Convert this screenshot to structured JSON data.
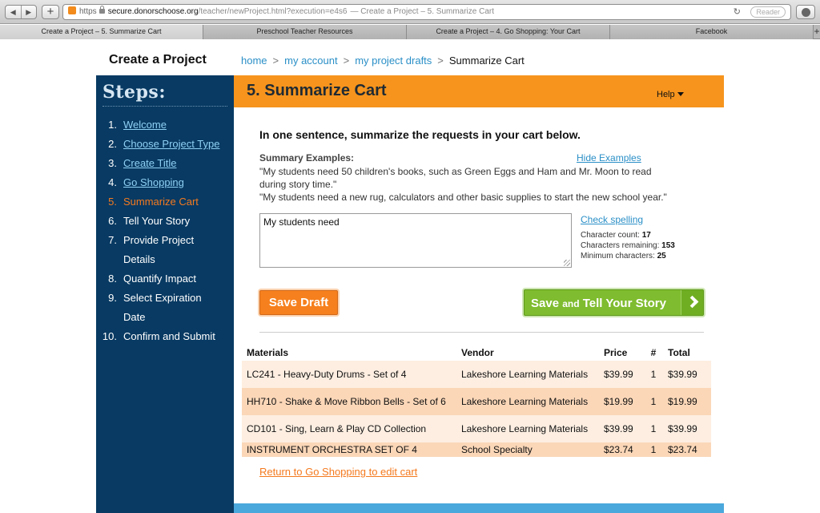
{
  "browser": {
    "url_scheme": "https",
    "url_domain": "secure.donorschoose.org",
    "url_path": "/teacher/newProject.html?execution=e4s6",
    "window_title": "— Create a Project – 5. Summarize Cart",
    "reload_icon": "reload-icon",
    "reader_label": "Reader",
    "tabs": [
      {
        "label": "Create a Project – 5. Summarize Cart"
      },
      {
        "label": "Preschool Teacher Resources"
      },
      {
        "label": "Create a Project – 4. Go Shopping: Your Cart"
      },
      {
        "label": "Facebook"
      }
    ],
    "new_tab_label": "+"
  },
  "header": {
    "title": "Create a Project",
    "breadcrumbs": [
      "home",
      "my account",
      "my project drafts"
    ],
    "breadcrumb_sep": ">",
    "breadcrumb_current": "Summarize Cart"
  },
  "sidebar": {
    "title": "Steps:",
    "steps": [
      {
        "num": "1.",
        "label": "Welcome"
      },
      {
        "num": "2.",
        "label": "Choose Project Type"
      },
      {
        "num": "3.",
        "label": "Create Title"
      },
      {
        "num": "4.",
        "label": "Go Shopping"
      },
      {
        "num": "5.",
        "label": "Summarize Cart"
      },
      {
        "num": "6.",
        "label": "Tell Your Story"
      },
      {
        "num": "7.",
        "label": "Provide Project",
        "label2": "Details"
      },
      {
        "num": "8.",
        "label": "Quantify Impact"
      },
      {
        "num": "9.",
        "label": "Select Expiration",
        "label2": "Date"
      },
      {
        "num": "10.",
        "label": "Confirm and Submit"
      }
    ]
  },
  "main": {
    "title": "5. Summarize Cart",
    "help_label": "Help",
    "instruction": "In one sentence, summarize the requests in your cart below.",
    "examples_label": "Summary Examples:",
    "hide_examples_label": "Hide Examples",
    "example_lines": [
      "\"My students need 50 children's books, such as Green Eggs and Ham and Mr. Moon to read",
      "during story time.\"",
      "\"My students need a new rug, calculators and other basic supplies to start the new school year.\""
    ],
    "summary_value": "My students need",
    "check_spelling_label": "Check spelling",
    "char_count_label": "Character count:",
    "char_count": "17",
    "chars_remaining_label": "Characters remaining:",
    "chars_remaining": "153",
    "min_chars_label": "Minimum characters:",
    "min_chars": "25",
    "save_draft_label": "Save Draft",
    "save_story_label_a": "Save",
    "save_story_label_b": "and",
    "save_story_label_c": "Tell Your Story",
    "return_link": "Return to Go Shopping to edit cart"
  },
  "cart": {
    "columns": [
      "Materials",
      "Vendor",
      "Price",
      "#",
      "Total"
    ],
    "rows": [
      {
        "material": "LC241 - Heavy-Duty Drums - Set of 4",
        "vendor": "Lakeshore Learning Materials",
        "price": "$39.99",
        "qty": "1",
        "total": "$39.99"
      },
      {
        "material": "HH710 - Shake & Move Ribbon Bells - Set of 6",
        "vendor": "Lakeshore Learning Materials",
        "price": "$19.99",
        "qty": "1",
        "total": "$19.99"
      },
      {
        "material": "CD101 - Sing, Learn & Play CD Collection",
        "vendor": "Lakeshore Learning Materials",
        "price": "$39.99",
        "qty": "1",
        "total": "$39.99"
      },
      {
        "material": "INSTRUMENT ORCHESTRA SET OF 4",
        "vendor": "School Specialty",
        "price": "$23.74",
        "qty": "1",
        "total": "$23.74"
      }
    ]
  },
  "colors": {
    "accent_orange": "#f6941d",
    "sidebar_navy": "#083a63",
    "link_blue": "#2a8fc7",
    "button_green": "#7fbc2f"
  }
}
